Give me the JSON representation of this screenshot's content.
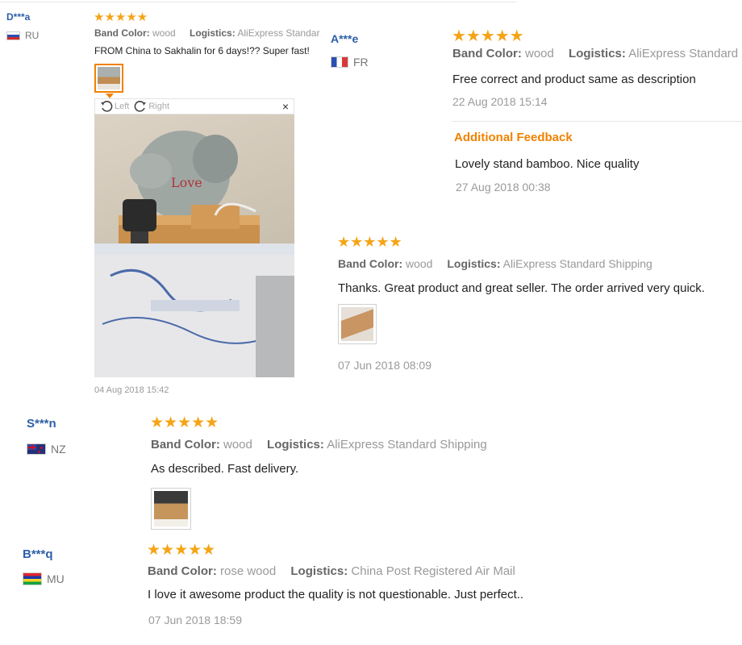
{
  "colors": {
    "star": "#f5a416",
    "name": "#2e5fa8",
    "additional": "#f08200"
  },
  "reviews": [
    {
      "name": "D***a",
      "country": "RU",
      "flag": "russia-flag-icon",
      "stars": "★★★★★",
      "band_label": "Band Color:",
      "band_value": "wood",
      "logistics_label": "Logistics:",
      "logistics_value": "AliExpress Standard Shi",
      "text": "FROM China to Sakhalin for 6 days!?? Super fast!",
      "viewer": {
        "left_label": "Left",
        "right_label": "Right",
        "close": "×"
      },
      "date": "04 Aug 2018 15:42"
    },
    {
      "name": "A***e",
      "country": "FR",
      "flag": "france-flag-icon",
      "stars": "★★★★★",
      "band_label": "Band Color:",
      "band_value": "wood",
      "logistics_label": "Logistics:",
      "logistics_value": "AliExpress Standard",
      "text": "Free correct and product same as description",
      "date": "22 Aug 2018 15:14",
      "additional_title": "Additional Feedback",
      "additional_text": "Lovely stand bamboo. Nice quality",
      "additional_date": "27 Aug 2018 00:38"
    },
    {
      "stars": "★★★★★",
      "band_label": "Band Color:",
      "band_value": "wood",
      "logistics_label": "Logistics:",
      "logistics_value": "AliExpress Standard Shipping",
      "text": "Thanks. Great product and great seller. The order arrived very quick.",
      "date": "07 Jun 2018 08:09"
    },
    {
      "name": "S***n",
      "country": "NZ",
      "flag": "new-zealand-flag-icon",
      "stars": "★★★★★",
      "band_label": "Band Color:",
      "band_value": "wood",
      "logistics_label": "Logistics:",
      "logistics_value": "AliExpress Standard Shipping",
      "text": "As described. Fast delivery."
    },
    {
      "name": "B***q",
      "country": "MU",
      "flag": "mauritius-flag-icon",
      "stars": "★★★★★",
      "band_label": "Band Color:",
      "band_value": "rose wood",
      "logistics_label": "Logistics:",
      "logistics_value": "China Post Registered Air Mail",
      "text": "I love it awesome product the quality is not questionable. Just perfect..",
      "date": "07 Jun 2018 18:59"
    }
  ]
}
